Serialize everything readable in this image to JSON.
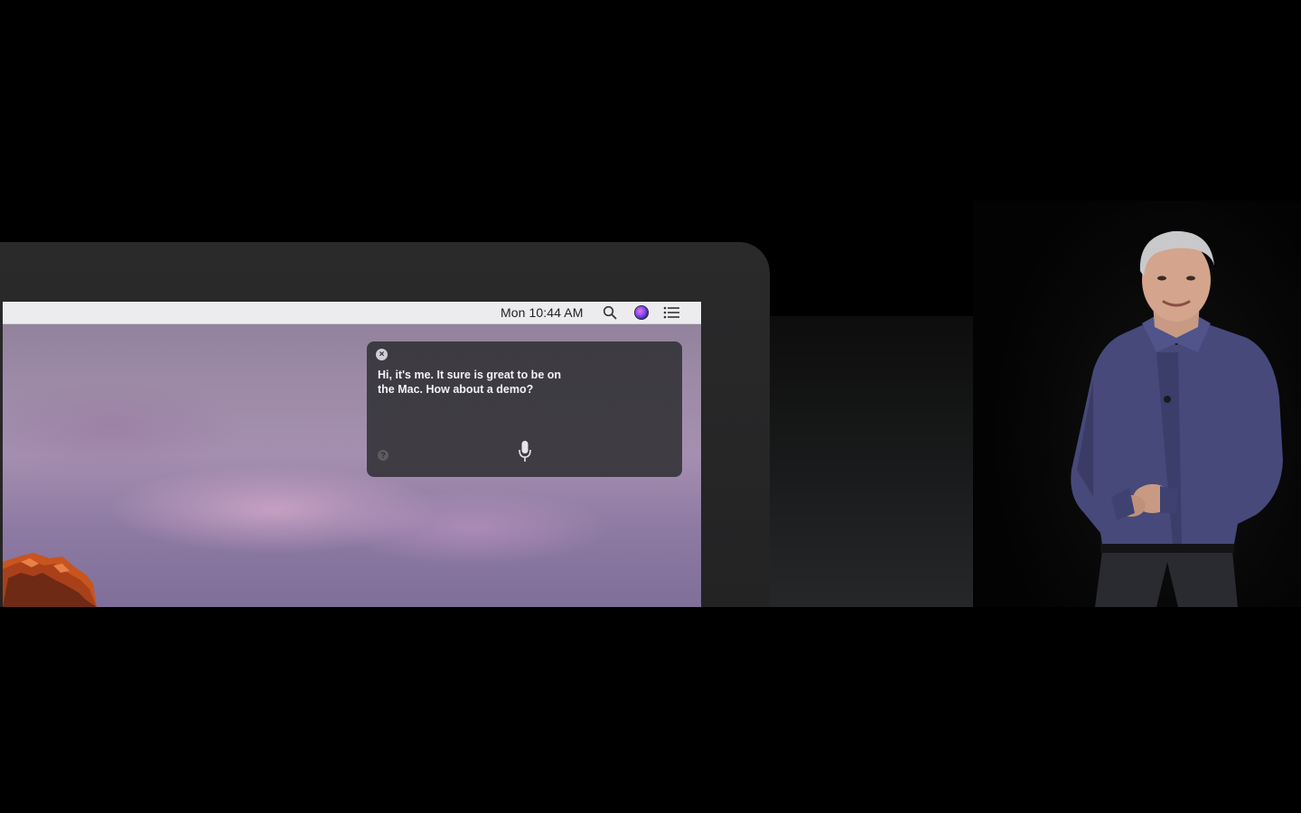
{
  "menubar": {
    "clock": "Mon 10:44 AM",
    "icons": [
      "search-icon",
      "siri-icon",
      "notification-center-icon"
    ]
  },
  "siri": {
    "close_glyph": "×",
    "message": "Hi, it's me. It sure is great to be on the Mac. How about a demo?",
    "help_glyph": "?",
    "mic_icon": "microphone-icon"
  },
  "colors": {
    "menubar_bg": "#ececee",
    "siri_panel_bg": "#2e2e32",
    "siri_text": "#f2f2f2",
    "bezel": "#2a2a2b",
    "stage_bg": "#000000"
  }
}
